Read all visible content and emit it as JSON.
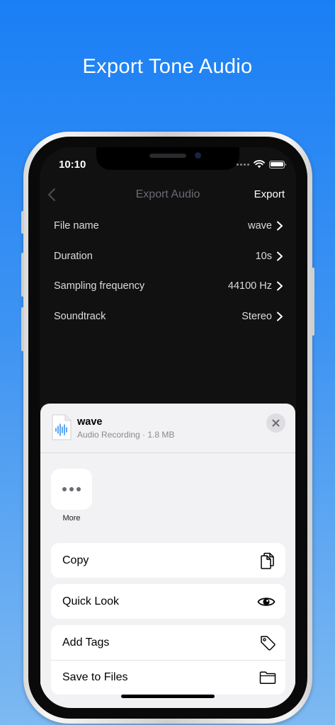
{
  "promo": {
    "title": "Export Tone Audio"
  },
  "status_bar": {
    "time": "10:10"
  },
  "nav": {
    "title": "Export Audio",
    "action": "Export"
  },
  "settings": [
    {
      "label": "File name",
      "value": "wave"
    },
    {
      "label": "Duration",
      "value": "10s"
    },
    {
      "label": "Sampling frequency",
      "value": "44100 Hz"
    },
    {
      "label": "Soundtrack",
      "value": "Stereo"
    }
  ],
  "share_sheet": {
    "file_name": "wave",
    "file_meta": "Audio Recording · 1.8 MB",
    "apps": [
      {
        "label": "More",
        "icon": "more-icon"
      }
    ],
    "actions": [
      {
        "label": "Copy",
        "icon": "copy-icon"
      },
      {
        "label": "Quick Look",
        "icon": "eye-icon"
      },
      {
        "label": "Add Tags",
        "icon": "tag-icon"
      },
      {
        "label": "Save to Files",
        "icon": "folder-icon"
      }
    ]
  },
  "colors": {
    "background_top": "#1a7ff5",
    "background_bottom": "#7db9f2",
    "screen_bg": "#111112",
    "sheet_bg": "#f2f2f4",
    "file_icon_accent": "#3b8ff0"
  }
}
